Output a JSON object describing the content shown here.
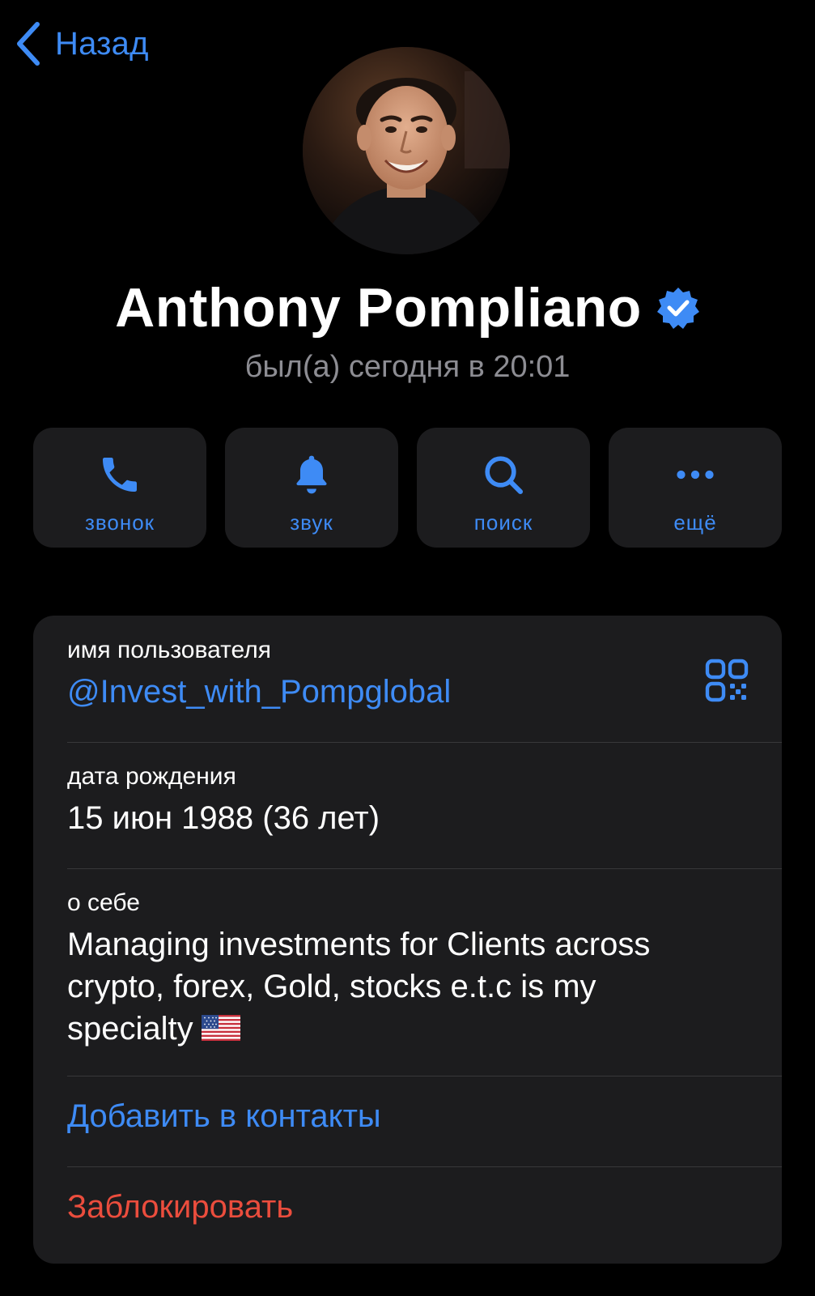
{
  "nav": {
    "back_label": "Назад"
  },
  "profile": {
    "name": "Anthony Pompliano",
    "verified": true,
    "last_seen": "был(а) сегодня в 20:01"
  },
  "actions": [
    {
      "label": "звонок",
      "icon": "phone-icon"
    },
    {
      "label": "звук",
      "icon": "bell-icon"
    },
    {
      "label": "поиск",
      "icon": "search-icon"
    },
    {
      "label": "ещё",
      "icon": "more-icon"
    }
  ],
  "info": {
    "username_title": "имя пользователя",
    "username_value": "@Invest_with_Pompglobal",
    "birthday_title": "дата рождения",
    "birthday_value": "15 июн 1988 (36 лет)",
    "bio_title": "о себе",
    "bio_line1": "Managing investments for Clients across",
    "bio_line2": "crypto, forex, Gold, stocks e.t.c is my",
    "bio_line3": "specialty",
    "bio_emoji": "us-flag",
    "add_contact": "Добавить в контакты",
    "block": "Заблокировать"
  },
  "colors": {
    "background": "#000000",
    "card": "#1c1c1e",
    "accent": "#3e8bf5",
    "destructive": "#eb4d3d",
    "secondary_text": "#8d8d93"
  }
}
